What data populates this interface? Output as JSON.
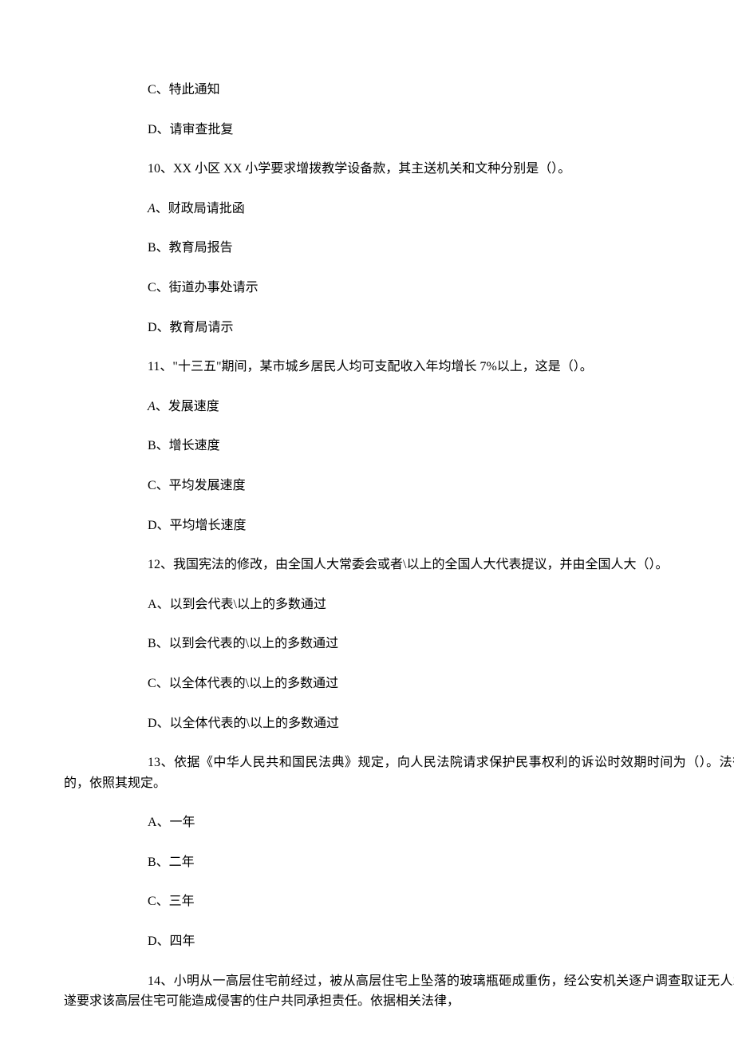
{
  "lines": {
    "l1": "C、特此通知",
    "l2": "D、请审查批复",
    "l3": "10、XX 小区 XX 小学要求增拨教学设备款，其主送机关和文种分别是（）。",
    "l4a": "A",
    "l4b": "、财政局请批函",
    "l5": "B、教育局报告",
    "l6": "C、街道办事处请示",
    "l7": "D、教育局请示",
    "l8": "11、\"十三五\"期间，某市城乡居民人均可支配收入年均增长 7%以上，这是（）。",
    "l9a": "A",
    "l9b": "、发展速度",
    "l10": "B、增长速度",
    "l11": "C、平均发展速度",
    "l12": "D、平均增长速度",
    "l13": "12、我国宪法的修改，由全国人大常委会或者\\以上的全国人大代表提议，并由全国人大（）。",
    "l14": "A、以到会代表\\以上的多数通过",
    "l15": "B、以到会代表的\\以上的多数通过",
    "l16": "C、以全体代表的\\以上的多数通过",
    "l17": "D、以全体代表的\\以上的多数通过",
    "l18": "13、依据《中华人民共和国民法典》规定，向人民法院请求保护民事权利的诉讼时效期时间为（）。法律另有规定的，依照其规定。",
    "l19": "A、一年",
    "l20": "B、二年",
    "l21": "C、三年",
    "l22": "D、四年",
    "l23": "14、小明从一高层住宅前经过，被从高层住宅上坠落的玻璃瓶砸成重伤，经公安机关逐户调查取证无人承认，小明遂要求该高层住宅可能造成侵害的住户共同承担责任。依据相关法律，"
  }
}
